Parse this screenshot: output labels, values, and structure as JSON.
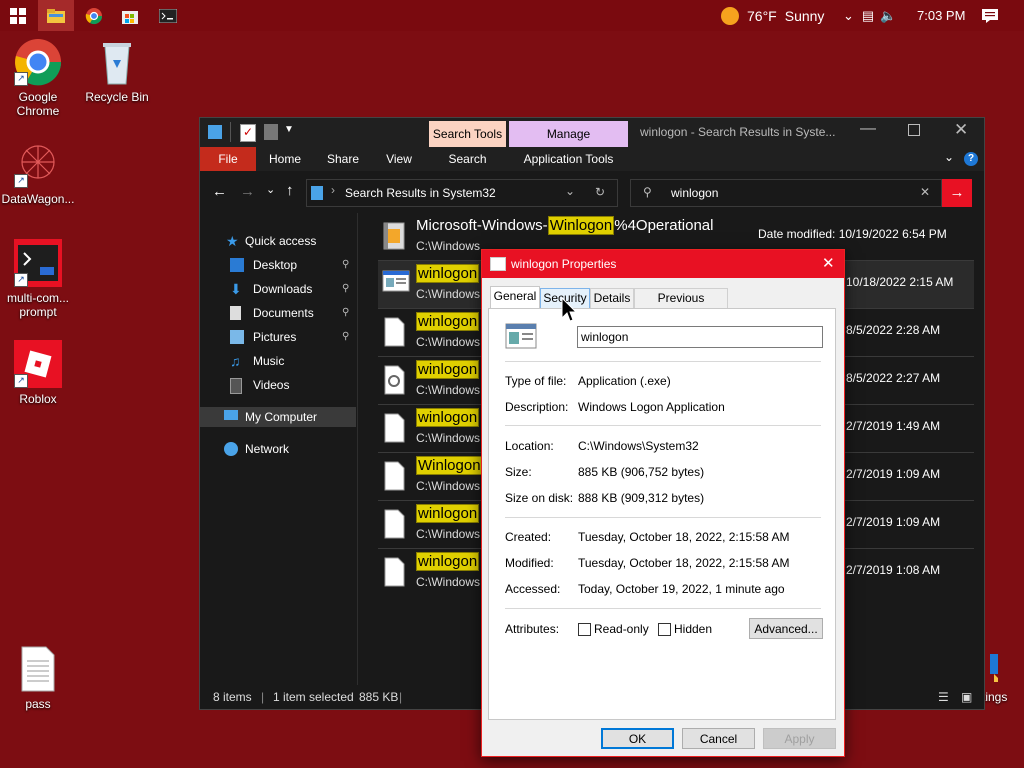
{
  "taskbar": {
    "weather": {
      "temp": "76°F",
      "condition": "Sunny"
    },
    "time": "7:03 PM"
  },
  "desktop_icons": [
    {
      "label": "Google Chrome"
    },
    {
      "label": "Recycle Bin"
    },
    {
      "label": "DataWagon..."
    },
    {
      "label": "multi-com... prompt"
    },
    {
      "label": "Roblox"
    },
    {
      "label": "pass"
    },
    {
      "label": "play settings"
    }
  ],
  "explorer": {
    "title": "winlogon - Search Results in Syste...",
    "context_tabs": {
      "search_tools": "Search Tools",
      "manage": "Manage"
    },
    "ribbon": {
      "file": "File",
      "home": "Home",
      "share": "Share",
      "view": "View",
      "search": "Search",
      "application_tools": "Application Tools"
    },
    "address": "Search Results in System32",
    "search_query": "winlogon",
    "nav": {
      "quick_access": "Quick access",
      "desktop": "Desktop",
      "downloads": "Downloads",
      "documents": "Documents",
      "pictures": "Pictures",
      "music": "Music",
      "videos": "Videos",
      "my_computer": "My Computer",
      "network": "Network"
    },
    "rows": [
      {
        "pre": "Microsoft-Windows-",
        "hl": "Winlogon",
        "post": "%4Operational",
        "path": "C:\\Windows",
        "mod": "Date modified: 10/19/2022 6:54 PM"
      },
      {
        "pre": "",
        "hl": "winlogon",
        "post": "",
        "path": "C:\\Windows",
        "mod": "10/18/2022 2:15 AM"
      },
      {
        "pre": "",
        "hl": "winlogon",
        "post": "",
        "path": "C:\\Windows",
        "mod": "8/5/2022 2:28 AM"
      },
      {
        "pre": "",
        "hl": "winlogon",
        "post": "",
        "path": "C:\\Windows",
        "mod": "8/5/2022 2:27 AM"
      },
      {
        "pre": "",
        "hl": "winlogon",
        "post": "",
        "path": "C:\\Windows",
        "mod": "2/7/2019 1:49 AM"
      },
      {
        "pre": "",
        "hl": "Winlogon",
        "post": "",
        "path": "C:\\Windows",
        "mod": "2/7/2019 1:09 AM"
      },
      {
        "pre": "",
        "hl": "winlogon",
        "post": "",
        "path": "C:\\Windows",
        "mod": "2/7/2019 1:09 AM"
      },
      {
        "pre": "",
        "hl": "winlogon",
        "post": "",
        "path": "C:\\Windows",
        "mod": "2/7/2019 1:08 AM"
      }
    ],
    "status": {
      "items": "8 items",
      "selected": "1 item selected",
      "size": "885 KB"
    }
  },
  "dialog": {
    "title": "winlogon Properties",
    "tabs": {
      "general": "General",
      "security": "Security",
      "details": "Details",
      "previous": "Previous Versions"
    },
    "filename": "winlogon",
    "fields": {
      "type_label": "Type of file:",
      "type_value": "Application (.exe)",
      "desc_label": "Description:",
      "desc_value": "Windows Logon Application",
      "loc_label": "Location:",
      "loc_value": "C:\\Windows\\System32",
      "size_label": "Size:",
      "size_value": "885 KB (906,752 bytes)",
      "disk_label": "Size on disk:",
      "disk_value": "888 KB (909,312 bytes)",
      "created_label": "Created:",
      "created_value": "Tuesday, October 18, 2022, 2:15:58 AM",
      "modified_label": "Modified:",
      "modified_value": "Tuesday, October 18, 2022, 2:15:58 AM",
      "accessed_label": "Accessed:",
      "accessed_value": "Today, October 19, 2022, 1 minute ago",
      "attr_label": "Attributes:",
      "readonly": "Read-only",
      "hidden": "Hidden",
      "advanced": "Advanced..."
    },
    "buttons": {
      "ok": "OK",
      "cancel": "Cancel",
      "apply": "Apply"
    }
  }
}
